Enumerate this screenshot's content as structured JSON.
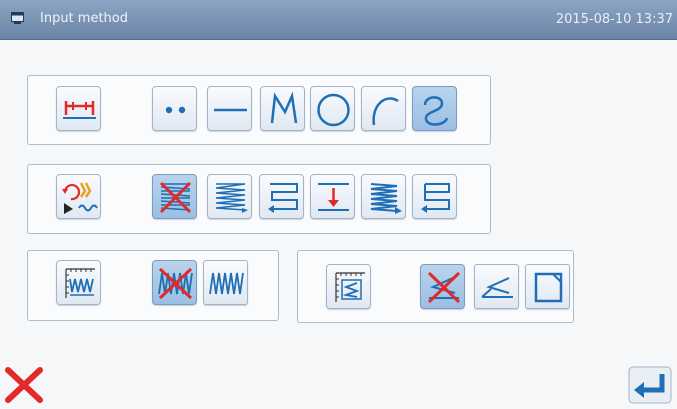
{
  "window": {
    "title": "Input method",
    "datetime": "2015-08-10 13:37",
    "titlebar_color": "#7890b2"
  },
  "colors": {
    "icon_blue": "#1e6fb5",
    "icon_red": "#e12a2a",
    "selected_bg": "#a9c9e8",
    "panel_border": "#a9bcd0"
  },
  "row1": {
    "setting": {
      "icon": "measure-bracket-icon"
    },
    "shapes": [
      {
        "icon": "point-dots-icon",
        "selected": false
      },
      {
        "icon": "straight-line-icon",
        "selected": false
      },
      {
        "icon": "polyline-icon",
        "selected": false
      },
      {
        "icon": "circle-icon",
        "selected": false
      },
      {
        "icon": "arc-icon",
        "selected": false
      },
      {
        "icon": "curve-icon",
        "selected": true
      }
    ]
  },
  "row2": {
    "setting": {
      "icon": "rotate-direction-icon"
    },
    "fills": [
      {
        "icon": "no-fill-icon",
        "selected": true
      },
      {
        "icon": "zigzag-fill-icon",
        "selected": false
      },
      {
        "icon": "reverse-fill-icon",
        "selected": false
      },
      {
        "icon": "down-arrow-fill-icon",
        "selected": false
      },
      {
        "icon": "dense-zigzag-icon",
        "selected": false
      },
      {
        "icon": "loop-back-fill-icon",
        "selected": false
      }
    ]
  },
  "row3_left": {
    "setting": {
      "icon": "zigzag-measure-icon"
    },
    "options": [
      {
        "icon": "no-zigzag-icon",
        "selected": true
      },
      {
        "icon": "zigzag-icon",
        "selected": false
      }
    ]
  },
  "row3_right": {
    "setting": {
      "icon": "step-measure-icon"
    },
    "options": [
      {
        "icon": "no-step-icon",
        "selected": true
      },
      {
        "icon": "step-stitch-icon",
        "selected": false
      },
      {
        "icon": "square-frame-icon",
        "selected": false
      }
    ]
  },
  "bottom": {
    "cancel": {
      "icon": "cancel-x-icon"
    },
    "confirm": {
      "icon": "enter-return-icon"
    }
  }
}
